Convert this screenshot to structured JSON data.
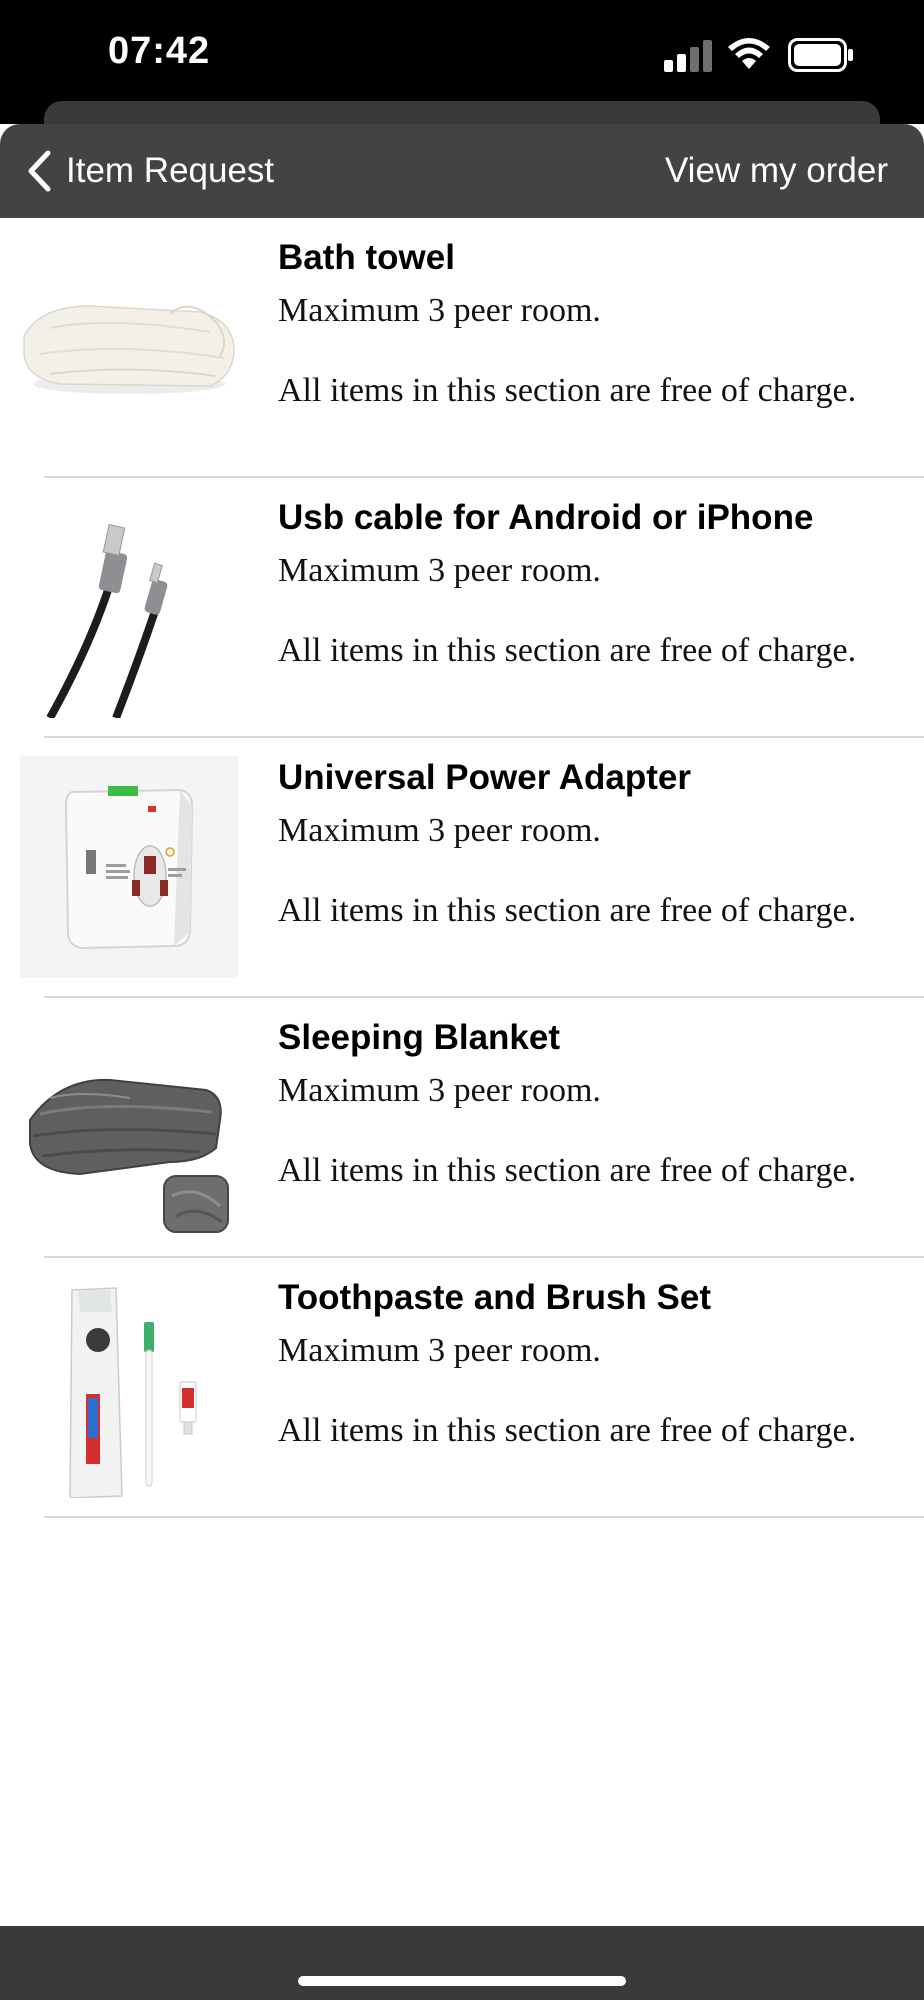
{
  "status_bar": {
    "time": "07:42",
    "icons": [
      "signal-icon",
      "wifi-icon",
      "battery-icon"
    ]
  },
  "nav": {
    "back_icon": "chevron-left-icon",
    "back_label": "Item Request",
    "action_label": "View my order"
  },
  "items": [
    {
      "title": "Bath towel",
      "limit": "Maximum 3 peer room.",
      "note": "All items in this section are free of charge.",
      "image": "bath-towel-image"
    },
    {
      "title": "Usb cable for Android or iPhone",
      "limit": "Maximum 3 peer room.",
      "note": "All items in this section are free of charge.",
      "image": "usb-cable-image"
    },
    {
      "title": "Universal Power Adapter",
      "limit": "Maximum 3 peer room.",
      "note": "All items in this section are free of charge.",
      "image": "power-adapter-image"
    },
    {
      "title": "Sleeping Blanket",
      "limit": "Maximum 3 peer room.",
      "note": "All items in this section are free of charge.",
      "image": "blanket-image"
    },
    {
      "title": "Toothpaste and Brush Set",
      "limit": "Maximum 3 peer room.",
      "note": "All items in this section are free of charge.",
      "image": "toothbrush-set-image"
    }
  ],
  "colors": {
    "status_bar_bg": "#000000",
    "nav_bar_bg": "#434345",
    "nav_text": "#ffffff",
    "list_bg": "#ffffff",
    "divider": "#d8d8d8",
    "home_bar_bg": "#3a3a3c"
  }
}
